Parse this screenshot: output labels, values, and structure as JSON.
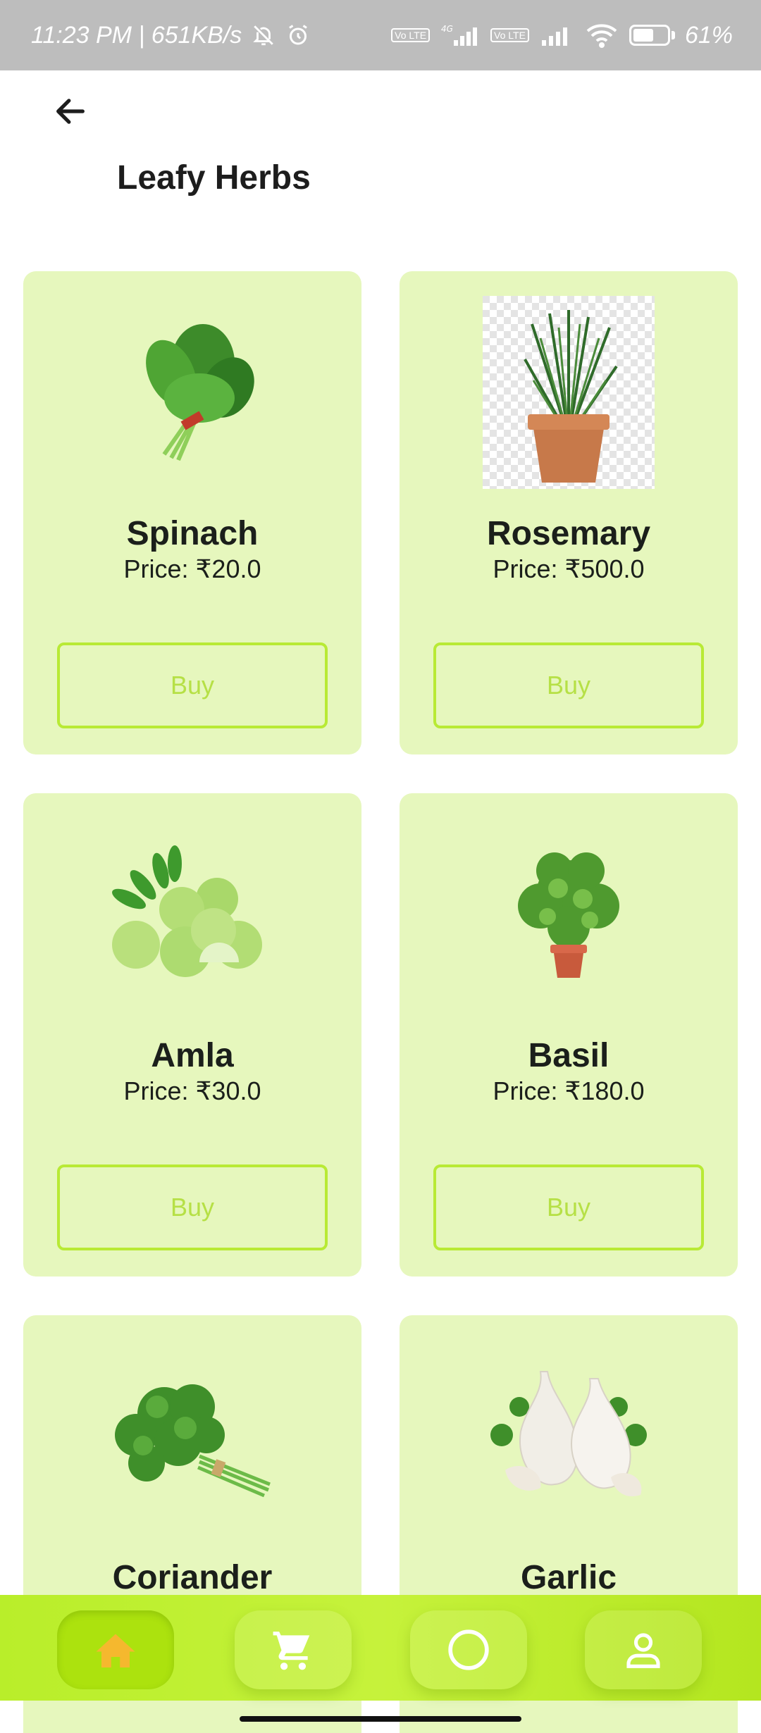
{
  "status_bar": {
    "time_speed": "11:23 PM | 651KB/s",
    "lte_label": "Vo LTE",
    "network_label": "4G",
    "battery": "61%",
    "battery_level": 0.61
  },
  "header": {
    "title": "Leafy Herbs",
    "back_icon": "arrow-left-icon"
  },
  "products": [
    {
      "name": "Spinach",
      "price": "Price: ₹20.0",
      "buy_label": "Buy"
    },
    {
      "name": "Rosemary",
      "price": "Price: ₹500.0",
      "buy_label": "Buy"
    },
    {
      "name": "Amla",
      "price": "Price: ₹30.0",
      "buy_label": "Buy"
    },
    {
      "name": "Basil",
      "price": "Price: ₹180.0",
      "buy_label": "Buy"
    },
    {
      "name": "Coriander"
    },
    {
      "name": "Garlic"
    }
  ],
  "bottom_nav": {
    "items": [
      {
        "icon": "home-icon",
        "active": true
      },
      {
        "icon": "cart-icon",
        "active": false
      },
      {
        "icon": "circle-icon",
        "active": false
      },
      {
        "icon": "profile-icon",
        "active": false
      }
    ]
  },
  "colors": {
    "card_bg": "#e6f7bd",
    "accent": "#b8ea35",
    "nav_bg": "#c1f032",
    "home_active": "#f5b82e"
  }
}
